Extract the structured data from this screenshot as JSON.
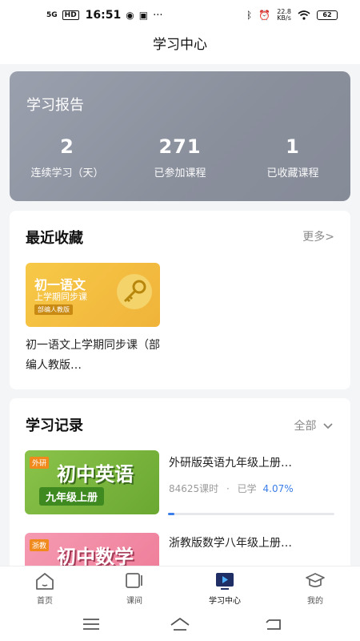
{
  "status_bar": {
    "signal": "5G",
    "hd": "HD",
    "time": "16:51",
    "net_speed_value": "22.8",
    "net_speed_unit": "KB/s",
    "battery": "62",
    "more": "···"
  },
  "header": {
    "title": "学习中心"
  },
  "report": {
    "title": "学习报告",
    "stats": [
      {
        "value": "2",
        "label": "连续学习（天）"
      },
      {
        "value": "271",
        "label": "已参加课程"
      },
      {
        "value": "1",
        "label": "已收藏课程"
      }
    ]
  },
  "favorites": {
    "title": "最近收藏",
    "more": "更多>",
    "items": [
      {
        "thumb_title": "初一语文",
        "thumb_subtitle": "上学期同步课",
        "thumb_tag": "部编人教版",
        "title": "初一语文上学期同步课（部编人教版…"
      }
    ]
  },
  "records": {
    "title": "学习记录",
    "filter": "全部",
    "items": [
      {
        "thumb_tag": "外研",
        "thumb_big": "初中英语",
        "thumb_grade": "九年级上册",
        "title": "外研版英语九年级上册…",
        "lessons": "84625课时",
        "dot": "·",
        "studied_label": "已学",
        "percent": "4.07%",
        "progress": 0.0407
      },
      {
        "thumb_tag": "浙教",
        "thumb_big": "初中数学",
        "title": "浙教版数学八年级上册…"
      }
    ]
  },
  "tabs": [
    {
      "label": "首页",
      "icon": "home-icon"
    },
    {
      "label": "课间",
      "icon": "break-icon"
    },
    {
      "label": "学习中心",
      "icon": "learning-center-icon",
      "active": true
    },
    {
      "label": "我的",
      "icon": "profile-icon"
    }
  ],
  "colors": {
    "accent": "#3b7de9",
    "report_bg": "#8e93a0"
  }
}
